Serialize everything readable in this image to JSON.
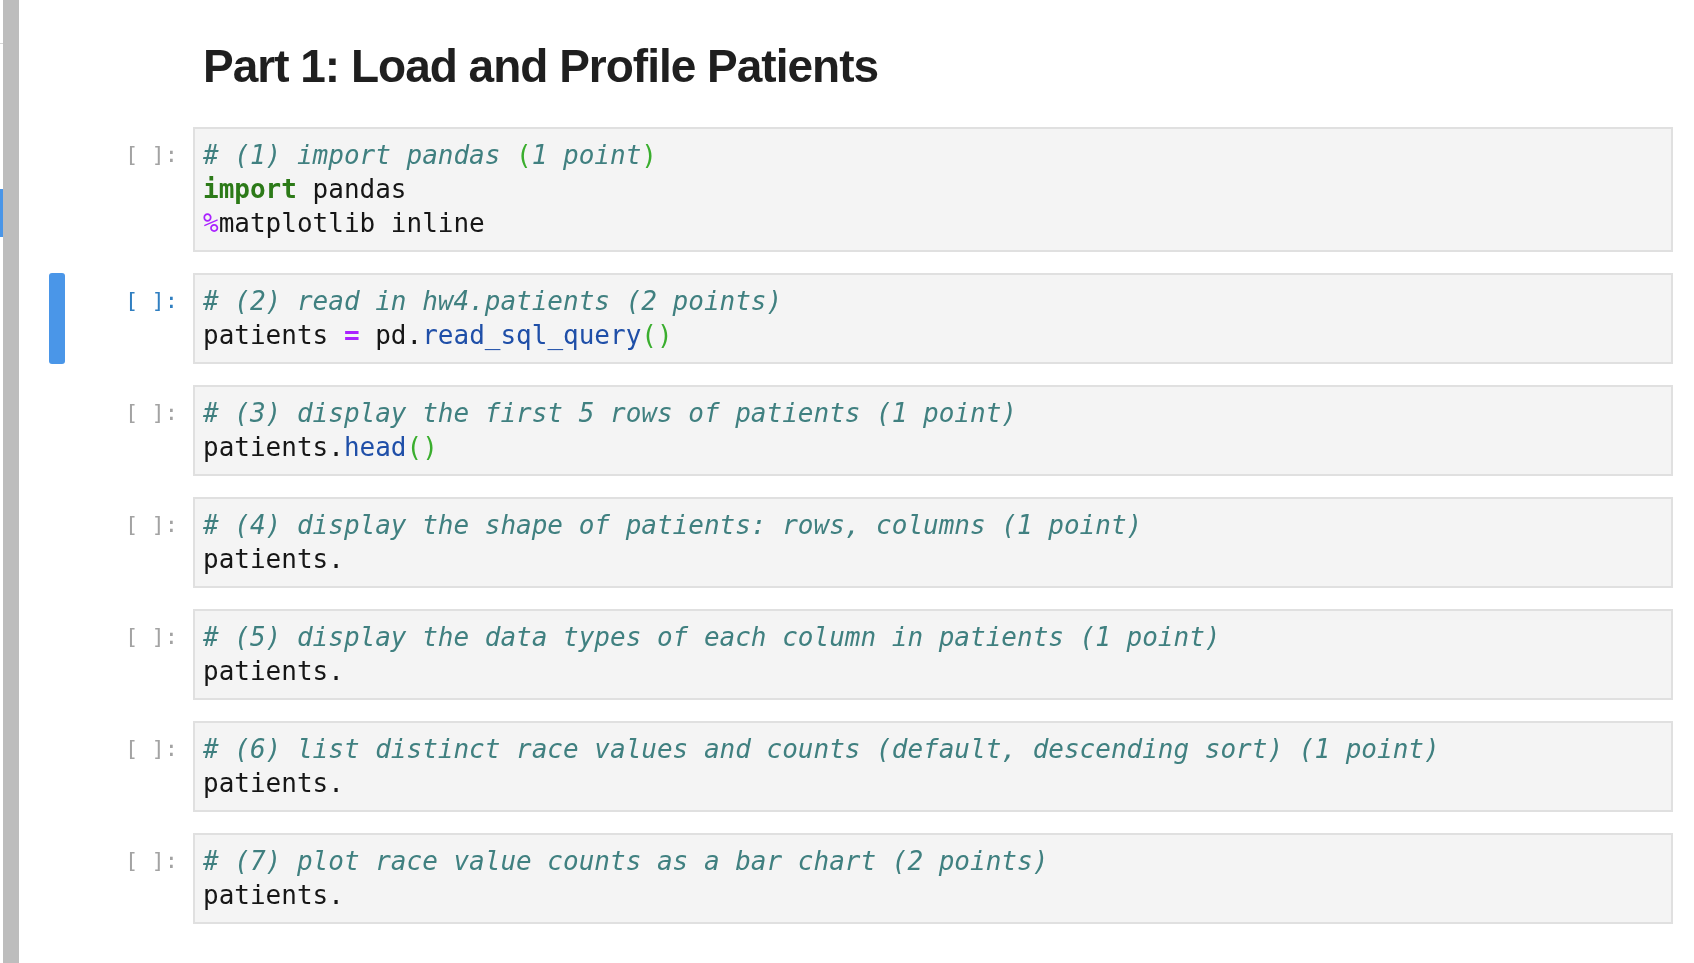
{
  "notebook": {
    "heading": "Part 1: Load and Profile Patients",
    "cells": [
      {
        "prompt": "[ ]:",
        "selected": false,
        "lines": [
          {
            "tokens": [
              {
                "kind": "comment",
                "text": "# (1) import pandas "
              },
              {
                "kind": "bracket",
                "text": "("
              },
              {
                "kind": "comment",
                "text": "1 point"
              },
              {
                "kind": "bracket",
                "text": ")"
              }
            ]
          },
          {
            "tokens": [
              {
                "kind": "keyword",
                "text": "import"
              },
              {
                "kind": "name",
                "text": " pandas"
              }
            ]
          },
          {
            "tokens": [
              {
                "kind": "magic",
                "text": "%"
              },
              {
                "kind": "name",
                "text": "matplotlib inline"
              }
            ]
          }
        ]
      },
      {
        "prompt": "[ ]:",
        "selected": true,
        "lines": [
          {
            "tokens": [
              {
                "kind": "comment",
                "text": "# (2) read in hw4.patients (2 points)"
              }
            ]
          },
          {
            "tokens": [
              {
                "kind": "name",
                "text": "patients "
              },
              {
                "kind": "operator",
                "text": "="
              },
              {
                "kind": "name",
                "text": " pd."
              },
              {
                "kind": "function",
                "text": "read_sql_query"
              },
              {
                "kind": "bracket",
                "text": "()"
              }
            ]
          }
        ]
      },
      {
        "prompt": "[ ]:",
        "selected": false,
        "lines": [
          {
            "tokens": [
              {
                "kind": "comment",
                "text": "# (3) display the first 5 rows of patients (1 point)"
              }
            ]
          },
          {
            "tokens": [
              {
                "kind": "name",
                "text": "patients."
              },
              {
                "kind": "function",
                "text": "head"
              },
              {
                "kind": "bracket",
                "text": "()"
              }
            ]
          }
        ]
      },
      {
        "prompt": "[ ]:",
        "selected": false,
        "lines": [
          {
            "tokens": [
              {
                "kind": "comment",
                "text": "# (4) display the shape of patients: rows, columns (1 point)"
              }
            ]
          },
          {
            "tokens": [
              {
                "kind": "name",
                "text": "patients."
              }
            ]
          }
        ]
      },
      {
        "prompt": "[ ]:",
        "selected": false,
        "lines": [
          {
            "tokens": [
              {
                "kind": "comment",
                "text": "# (5) display the data types of each column in patients (1 point)"
              }
            ]
          },
          {
            "tokens": [
              {
                "kind": "name",
                "text": "patients."
              }
            ]
          }
        ]
      },
      {
        "prompt": "[ ]:",
        "selected": false,
        "lines": [
          {
            "tokens": [
              {
                "kind": "comment",
                "text": "# (6) list distinct race values and counts (default, descending sort) (1 point)"
              }
            ]
          },
          {
            "tokens": [
              {
                "kind": "name",
                "text": "patients."
              }
            ]
          }
        ]
      },
      {
        "prompt": "[ ]:",
        "selected": false,
        "lines": [
          {
            "tokens": [
              {
                "kind": "comment",
                "text": "# (7) plot race value counts as a bar chart (2 points)"
              }
            ]
          },
          {
            "tokens": [
              {
                "kind": "name",
                "text": "patients."
              }
            ]
          }
        ]
      }
    ]
  }
}
